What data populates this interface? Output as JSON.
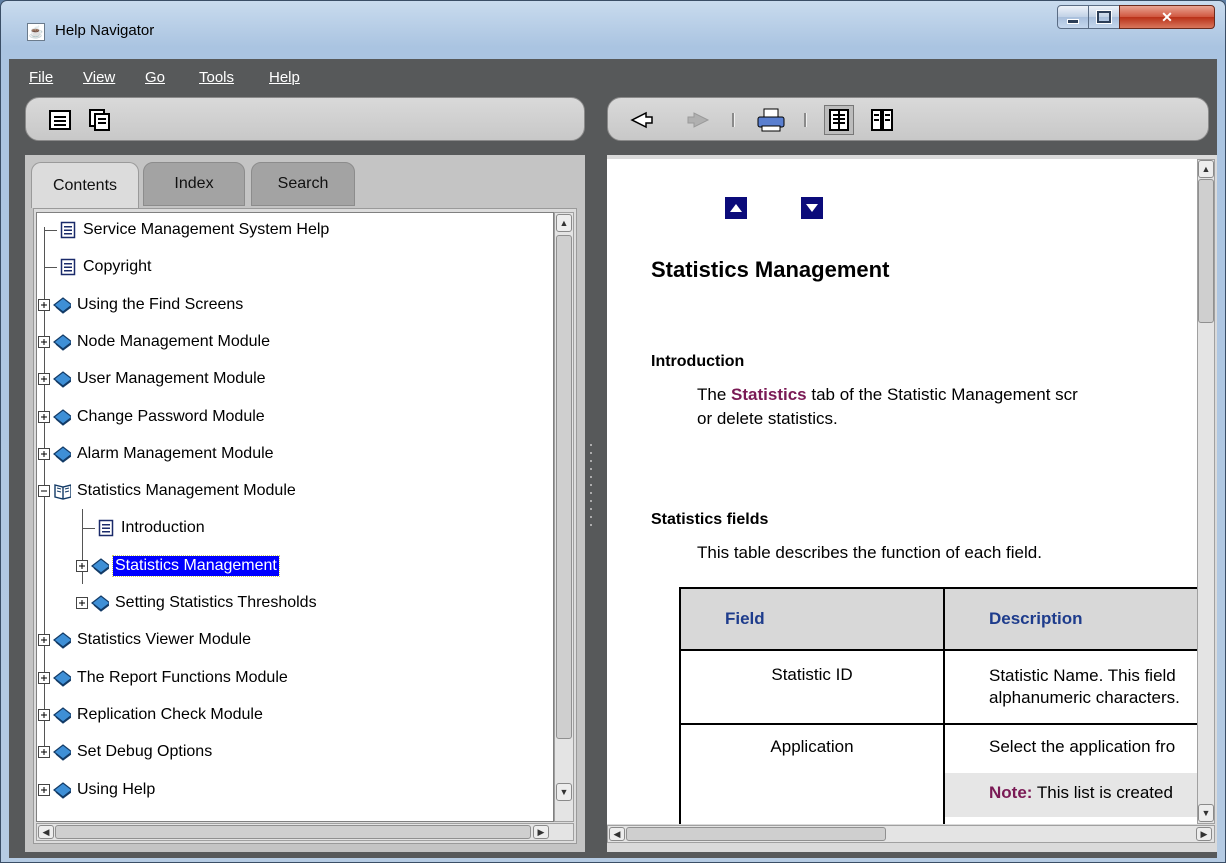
{
  "window": {
    "title": "Help Navigator",
    "app_icon": "java-icon"
  },
  "menu": [
    "File",
    "View",
    "Go",
    "Tools",
    "Help"
  ],
  "tabs": [
    "Contents",
    "Index",
    "Search"
  ],
  "tree": [
    {
      "label": "Service Management System Help",
      "icon": "page-icon",
      "expander": false
    },
    {
      "label": "Copyright",
      "icon": "page-icon",
      "expander": false
    },
    {
      "label": "Using the Find Screens",
      "icon": "book-closed-icon",
      "expander": true
    },
    {
      "label": "Node Management Module",
      "icon": "book-closed-icon",
      "expander": true
    },
    {
      "label": "User Management Module",
      "icon": "book-closed-icon",
      "expander": true
    },
    {
      "label": "Change Password Module",
      "icon": "book-closed-icon",
      "expander": true
    },
    {
      "label": "Alarm Management Module",
      "icon": "book-closed-icon",
      "expander": true
    },
    {
      "label": "Statistics Management Module",
      "icon": "book-open-icon",
      "expander": true
    },
    {
      "label": "Introduction",
      "icon": "page-icon",
      "expander": false
    },
    {
      "label": "Statistics Management",
      "icon": "book-closed-icon",
      "expander": true,
      "selected": true
    },
    {
      "label": "Setting Statistics Thresholds",
      "icon": "book-closed-icon",
      "expander": true
    },
    {
      "label": "Statistics Viewer Module",
      "icon": "book-closed-icon",
      "expander": true
    },
    {
      "label": "The Report Functions Module",
      "icon": "book-closed-icon",
      "expander": true
    },
    {
      "label": "Replication Check Module",
      "icon": "book-closed-icon",
      "expander": true
    },
    {
      "label": "Set Debug Options",
      "icon": "book-closed-icon",
      "expander": true
    },
    {
      "label": "Using Help",
      "icon": "book-closed-icon",
      "expander": true
    }
  ],
  "document": {
    "title": "Statistics Management",
    "intro_heading": "Introduction",
    "intro_pre": "The ",
    "intro_highlight": "Statistics",
    "intro_post": " tab of the Statistic Management scr",
    "intro_line2": "or delete statistics.",
    "fields_heading": "Statistics fields",
    "fields_text": "This table describes the function of each field.",
    "table_headers": [
      "Field",
      "Description"
    ],
    "rows": [
      {
        "field": "Statistic ID",
        "desc1": "Statistic Name. This field",
        "desc2": "alphanumeric characters."
      },
      {
        "field": "Application",
        "desc1": "Select the application fro",
        "note_label": "Note:",
        "note_text": " This list is created"
      }
    ]
  },
  "colors": {
    "selection": "#0000ff",
    "highlight_text": "#7a1a55",
    "table_header_text": "#1e3c8c",
    "nav_arrow": "#0b0b7a"
  }
}
